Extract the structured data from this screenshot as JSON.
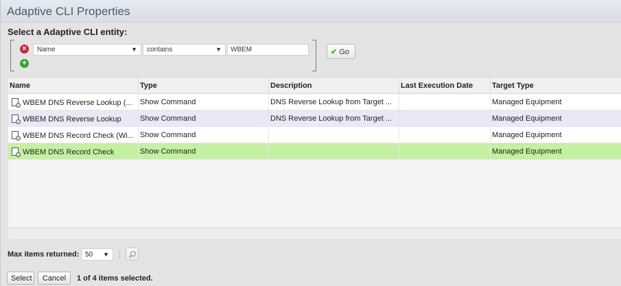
{
  "dialog": {
    "title": "Adaptive CLI Properties",
    "subtitle": "Select a Adaptive CLI entity:"
  },
  "filter": {
    "field": "Name",
    "operator": "contains",
    "value": "WBEM",
    "go_label": "Go"
  },
  "grid": {
    "columns": [
      "Name",
      "Type",
      "Description",
      "Last Execution Date",
      "Target Type"
    ],
    "rows": [
      {
        "name": "WBEM DNS Reverse Lookup (...",
        "type": "Show Command",
        "description": "DNS Reverse Lookup from Target ...",
        "last_execution": "",
        "target_type": "Managed Equipment"
      },
      {
        "name": "WBEM DNS Reverse Lookup",
        "type": "Show Command",
        "description": "DNS Reverse Lookup from Target ...",
        "last_execution": "",
        "target_type": "Managed Equipment"
      },
      {
        "name": "WBEM DNS Record Check (Wi...",
        "type": "Show Command",
        "description": "",
        "last_execution": "",
        "target_type": "Managed Equipment"
      },
      {
        "name": "WBEM DNS Record Check",
        "type": "Show Command",
        "description": "",
        "last_execution": "",
        "target_type": "Managed Equipment"
      }
    ]
  },
  "max_items": {
    "label": "Max items returned:",
    "value": "50"
  },
  "footer": {
    "select_label": "Select",
    "cancel_label": "Cancel",
    "status": "1 of 4 items selected."
  },
  "colors": {
    "selected_row": "#c4f0a2",
    "alt_row": "#e8e8f6",
    "title_text": "#4b5a6d"
  }
}
